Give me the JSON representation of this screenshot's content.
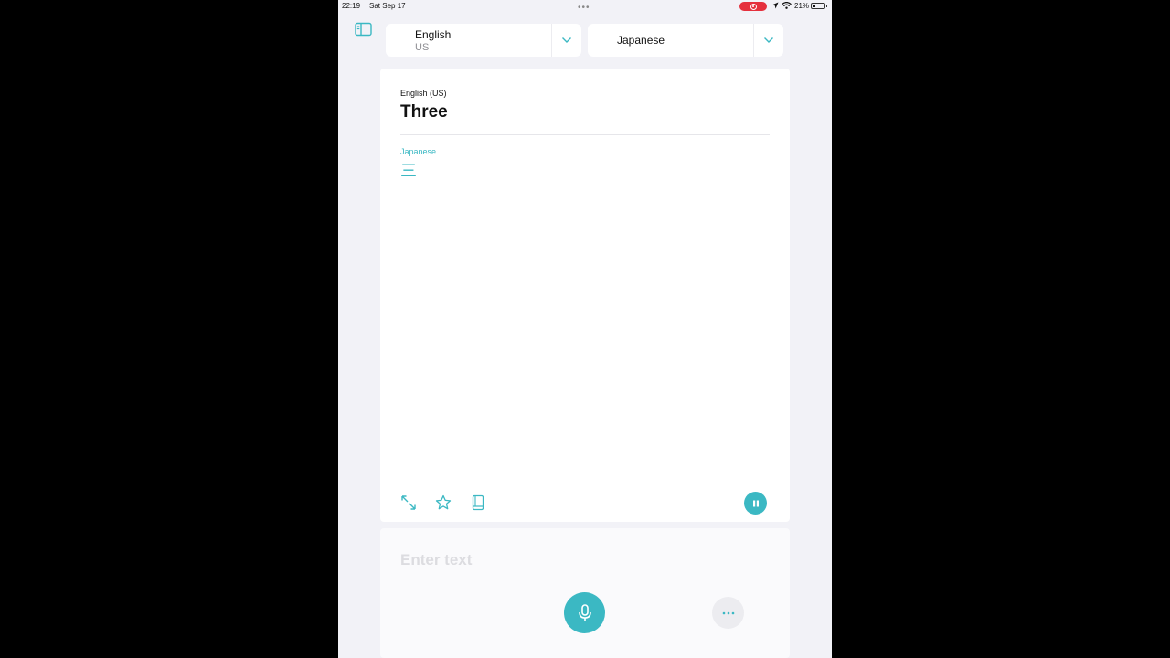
{
  "status_bar": {
    "time": "22:19",
    "date": "Sat Sep 17",
    "battery_text": "21%",
    "battery_level": 0.21,
    "recording_color": "#e5303d"
  },
  "language_bar": {
    "sidebar_icon": "sidebar-icon",
    "source": {
      "name": "English",
      "region": "US"
    },
    "target": {
      "name": "Japanese"
    },
    "chevron_icon": "chevron-down-icon"
  },
  "translation": {
    "source_label": "English (US)",
    "source_text": "Three",
    "target_label": "Japanese",
    "target_text": "三",
    "tools": [
      "expand-icon",
      "star-icon",
      "book-icon"
    ],
    "playback_icon": "pause-icon"
  },
  "input": {
    "placeholder": "Enter text",
    "value": "",
    "mic_icon": "microphone-icon",
    "more_icon": "ellipsis-icon"
  },
  "colors": {
    "accent": "#3bb8c3",
    "background": "#f2f2f7",
    "card": "#ffffff"
  }
}
